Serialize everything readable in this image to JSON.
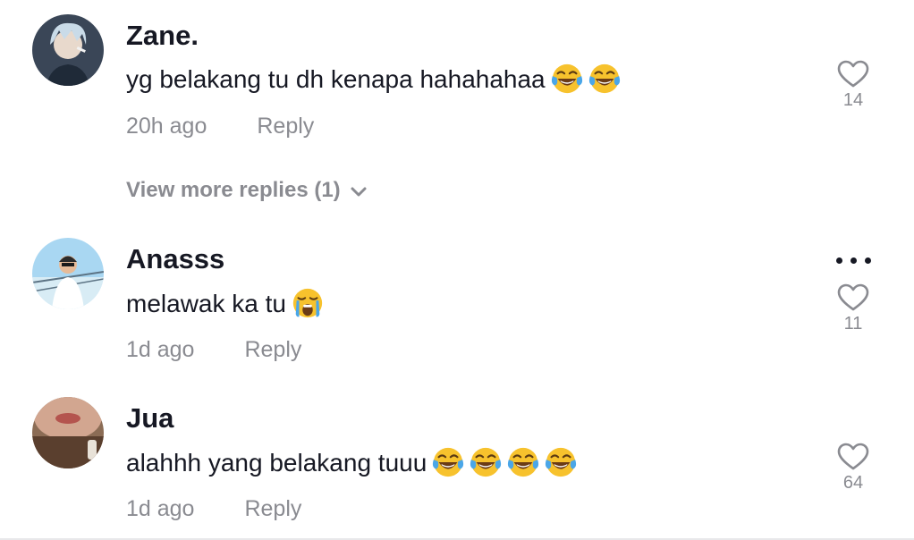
{
  "comments": [
    {
      "username": "Zane.",
      "text": "yg belakang tu dh kenapa hahahahaa",
      "time": "20h ago",
      "reply_label": "Reply",
      "likes": "14",
      "emojis": [
        "face-with-tears-of-joy",
        "face-with-tears-of-joy"
      ]
    },
    {
      "username": "Anasss",
      "text": "melawak ka tu",
      "time": "1d ago",
      "reply_label": "Reply",
      "likes": "11",
      "emojis": [
        "loudly-crying-face"
      ]
    },
    {
      "username": "Jua",
      "text": "alahhh yang belakang tuuu",
      "time": "1d ago",
      "reply_label": "Reply",
      "likes": "64",
      "emojis": [
        "face-with-tears-of-joy",
        "face-with-tears-of-joy",
        "face-with-tears-of-joy",
        "face-with-tears-of-joy"
      ]
    }
  ],
  "view_more_replies": "View more replies (1)",
  "icons": {
    "like": "heart-outline-icon",
    "more": "more-dots-icon",
    "expand": "chevron-down-icon"
  },
  "colors": {
    "primary_text": "#161823",
    "secondary_text": "#8a8b91",
    "emoji_face": "#f7c22d",
    "emoji_tears": "#4aa6e8"
  }
}
